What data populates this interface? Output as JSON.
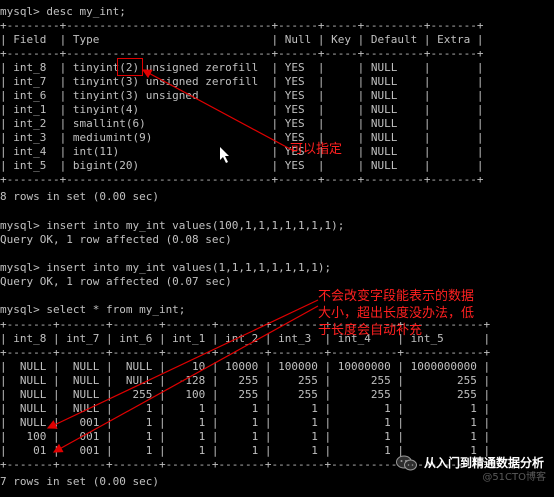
{
  "terminal": {
    "lines": [
      "mysql> desc my_int;",
      "+--------+-------------------------------+------+-----+---------+-------+",
      "| Field  | Type                          | Null | Key | Default | Extra |",
      "+--------+-------------------------------+------+-----+---------+-------+",
      "| int_8  | tinyint(2) unsigned zerofill  | YES  |     | NULL    |       |",
      "| int_7  | tinyint(3) unsigned zerofill  | YES  |     | NULL    |       |",
      "| int_6  | tinyint(3) unsigned           | YES  |     | NULL    |       |",
      "| int_1  | tinyint(4)                    | YES  |     | NULL    |       |",
      "| int_2  | smallint(6)                   | YES  |     | NULL    |       |",
      "| int_3  | mediumint(9)                  | YES  |     | NULL    |       |",
      "| int_4  | int(11)                       | YES  |     | NULL    |       |",
      "| int_5  | bigint(20)                    | YES  |     | NULL    |       |",
      "+--------+-------------------------------+------+-----+---------+-------+",
      "8 rows in set (0.00 sec)",
      "",
      "mysql> insert into my_int values(100,1,1,1,1,1,1,1);",
      "Query OK, 1 row affected (0.08 sec)",
      "",
      "mysql> insert into my_int values(1,1,1,1,1,1,1,1);",
      "Query OK, 1 row affected (0.07 sec)",
      "",
      "mysql> select * from my_int;",
      "+-------+-------+-------+-------+-------+--------+----------+------------+",
      "| int_8 | int_7 | int_6 | int_1 | int_2 | int_3  | int_4    | int_5      |",
      "+-------+-------+-------+-------+-------+--------+----------+------------+",
      "|  NULL |  NULL |  NULL |    10 | 10000 | 100000 | 10000000 | 1000000000 |",
      "|  NULL |  NULL |  NULL |  -128 |   255 |    255 |      255 |        255 |",
      "|  NULL |  NULL |   255 |   100 |   255 |    255 |      255 |        255 |",
      "|  NULL |  NULL |     1 |     1 |     1 |      1 |        1 |          1 |",
      "|  NULL |   001 |     1 |     1 |     1 |      1 |        1 |          1 |",
      "|   100 |   001 |     1 |     1 |     1 |      1 |        1 |          1 |",
      "|    01 |   001 |     1 |     1 |     1 |      1 |        1 |          1 |",
      "+-------+-------+-------+-------+-------+--------+----------+------------+",
      "7 rows in set (0.00 sec)"
    ]
  },
  "annotations": {
    "note_1": "可以指定",
    "note_2": "不会改变字段能表示的数据\n大小，超出长度没办法，低\n于长度会自动补充"
  },
  "watermark": {
    "title": "从入门到精通数据分析",
    "sub": "@51CTO博客"
  },
  "colors": {
    "terminal_text": "#c0c0c0",
    "annotation": "#ff2020",
    "background": "#000000"
  },
  "icons": [
    "wechat-icon"
  ]
}
